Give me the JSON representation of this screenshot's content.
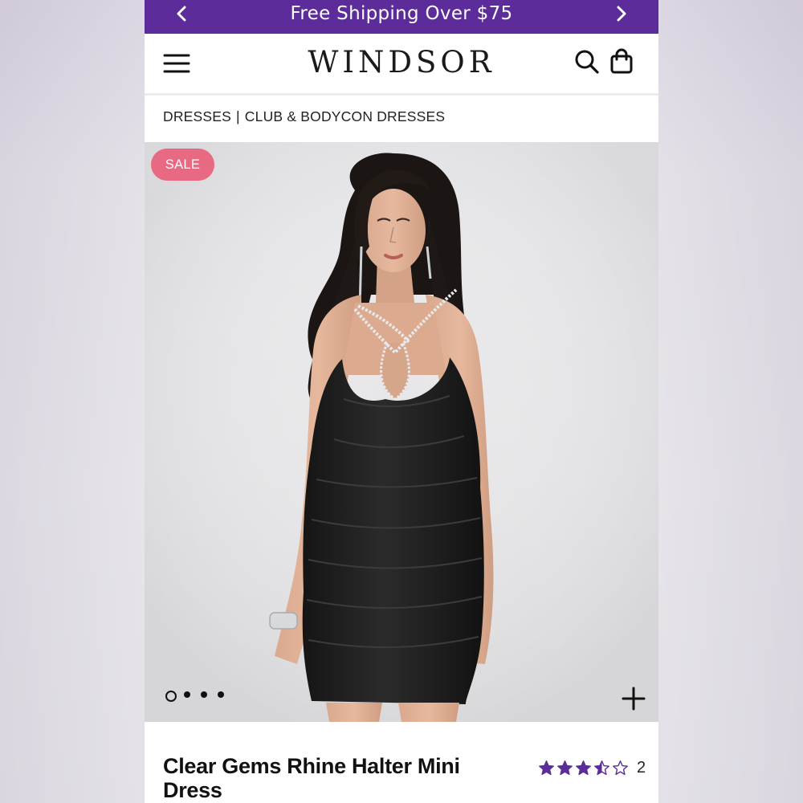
{
  "promo": {
    "message": "Free Shipping Over $75",
    "prev_icon": "chevron-left-icon",
    "next_icon": "chevron-right-icon",
    "background": "#5b2c9a"
  },
  "header": {
    "brand": "WINDSOR",
    "menu_icon": "hamburger-menu-icon",
    "search_icon": "search-icon",
    "bag_icon": "shopping-bag-icon"
  },
  "breadcrumb": {
    "items": [
      "DRESSES",
      "CLUB & BODYCON DRESSES"
    ],
    "separator": "|"
  },
  "gallery": {
    "badge": "SALE",
    "badge_color": "#e86a82",
    "image_count": 4,
    "active_index": 0,
    "zoom_icon": "plus-icon"
  },
  "product": {
    "title": "Clear Gems Rhine Halter Mini Dress",
    "rating": 3.5,
    "rating_max": 5,
    "review_count": "2",
    "star_color": "#5b2c9a"
  }
}
